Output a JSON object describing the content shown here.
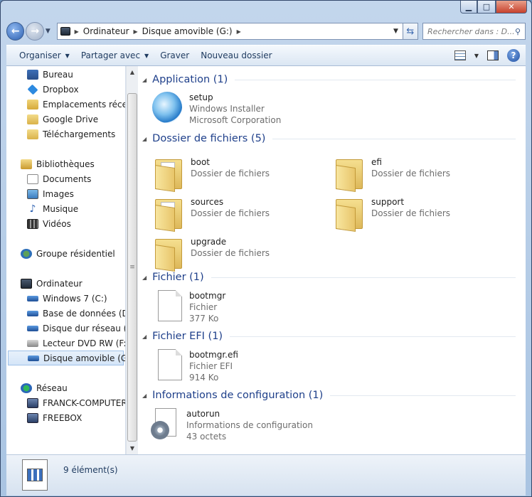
{
  "window": {
    "caption": {
      "minimize": "▁",
      "maximize": "□",
      "close": "✕"
    }
  },
  "address": {
    "crumbs": [
      "Ordinateur",
      "Disque amovible (G:)"
    ],
    "search_placeholder": "Rechercher dans : D..."
  },
  "toolbar": {
    "organize": "Organiser",
    "share": "Partager avec",
    "burn": "Graver",
    "new_folder": "Nouveau dossier",
    "help": "?"
  },
  "sidebar": {
    "favorites": [
      {
        "label": "Bureau",
        "icon": "desktop-icon"
      },
      {
        "label": "Dropbox",
        "icon": "dropbox-icon"
      },
      {
        "label": "Emplacements récents",
        "icon": "recent-places-icon"
      },
      {
        "label": "Google Drive",
        "icon": "folder-icon"
      },
      {
        "label": "Téléchargements",
        "icon": "downloads-icon"
      }
    ],
    "libraries": {
      "label": "Bibliothèques",
      "items": [
        "Documents",
        "Images",
        "Musique",
        "Vidéos"
      ]
    },
    "homegroup": "Groupe résidentiel",
    "computer": {
      "label": "Ordinateur",
      "items": [
        "Windows 7 (C:)",
        "Base de données (D:)",
        "Disque dur réseau (E:)",
        "Lecteur DVD RW (F:) M",
        "Disque amovible (G:)"
      ]
    },
    "network": {
      "label": "Réseau",
      "items": [
        "FRANCK-COMPUTER",
        "FREEBOX"
      ]
    }
  },
  "groups": {
    "application": {
      "title": "Application (1)",
      "items": [
        {
          "name": "setup",
          "line1": "Windows Installer",
          "line2": "Microsoft Corporation"
        }
      ]
    },
    "folders": {
      "title": "Dossier de fichiers (5)",
      "items": [
        {
          "name": "boot",
          "type": "Dossier de fichiers"
        },
        {
          "name": "efi",
          "type": "Dossier de fichiers"
        },
        {
          "name": "sources",
          "type": "Dossier de fichiers"
        },
        {
          "name": "support",
          "type": "Dossier de fichiers"
        },
        {
          "name": "upgrade",
          "type": "Dossier de fichiers"
        }
      ]
    },
    "file": {
      "title": "Fichier (1)",
      "items": [
        {
          "name": "bootmgr",
          "type": "Fichier",
          "size": "377 Ko"
        }
      ]
    },
    "efi_file": {
      "title": "Fichier EFI (1)",
      "items": [
        {
          "name": "bootmgr.efi",
          "type": "Fichier EFI",
          "size": "914 Ko"
        }
      ]
    },
    "config": {
      "title": "Informations de configuration (1)",
      "items": [
        {
          "name": "autorun",
          "type": "Informations de configuration",
          "size": "43 octets"
        }
      ]
    }
  },
  "status": {
    "count": "9 élément(s)"
  }
}
